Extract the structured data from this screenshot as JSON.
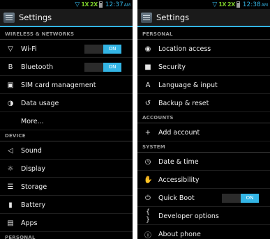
{
  "colors": {
    "accent": "#33b5e5",
    "signal": "#7acc29",
    "background": "#000000",
    "section_text": "#9a9a9a"
  },
  "left": {
    "status": {
      "clock": "12:37",
      "ampm": "AM",
      "sig1": "1X",
      "sig2": "2X"
    },
    "title": "Settings",
    "sections": [
      {
        "header": "WIRELESS & NETWORKS",
        "items": [
          {
            "label": "Wi-Fi",
            "icon": "wifi-icon",
            "glyph": "▽",
            "toggle": "ON"
          },
          {
            "label": "Bluetooth",
            "icon": "bluetooth-icon",
            "glyph": "B",
            "toggle": "ON"
          },
          {
            "label": "SIM card management",
            "icon": "sim-card-icon",
            "glyph": "▣"
          },
          {
            "label": "Data usage",
            "icon": "data-usage-icon",
            "glyph": "◑"
          },
          {
            "label": "More...",
            "icon": "",
            "glyph": ""
          }
        ]
      },
      {
        "header": "DEVICE",
        "items": [
          {
            "label": "Sound",
            "icon": "speaker-icon",
            "glyph": "◁"
          },
          {
            "label": "Display",
            "icon": "display-icon",
            "glyph": "☼"
          },
          {
            "label": "Storage",
            "icon": "storage-icon",
            "glyph": "☰"
          },
          {
            "label": "Battery",
            "icon": "battery-icon",
            "glyph": "▮"
          },
          {
            "label": "Apps",
            "icon": "apps-icon",
            "glyph": "▤"
          }
        ]
      },
      {
        "header": "PERSONAL",
        "items": []
      }
    ]
  },
  "right": {
    "status": {
      "clock": "12:38",
      "ampm": "AM",
      "sig1": "1X",
      "sig2": "2X"
    },
    "title": "Settings",
    "sections": [
      {
        "header": "PERSONAL",
        "items": [
          {
            "label": "Location access",
            "icon": "location-icon",
            "glyph": "◉"
          },
          {
            "label": "Security",
            "icon": "lock-icon",
            "glyph": "■"
          },
          {
            "label": "Language & input",
            "icon": "language-icon",
            "glyph": "A"
          },
          {
            "label": "Backup & reset",
            "icon": "backup-icon",
            "glyph": "↺"
          }
        ]
      },
      {
        "header": "ACCOUNTS",
        "items": [
          {
            "label": "Add account",
            "icon": "plus-icon",
            "glyph": "+"
          }
        ]
      },
      {
        "header": "SYSTEM",
        "items": [
          {
            "label": "Date & time",
            "icon": "clock-icon",
            "glyph": "◷"
          },
          {
            "label": "Accessibility",
            "icon": "hand-icon",
            "glyph": "✋"
          },
          {
            "label": "Quick Boot",
            "icon": "power-icon",
            "glyph": "⏻",
            "toggle": "ON"
          },
          {
            "label": "Developer options",
            "icon": "braces-icon",
            "glyph": "{ }"
          },
          {
            "label": "About phone",
            "icon": "info-icon",
            "glyph": "ⓘ"
          }
        ]
      }
    ]
  }
}
